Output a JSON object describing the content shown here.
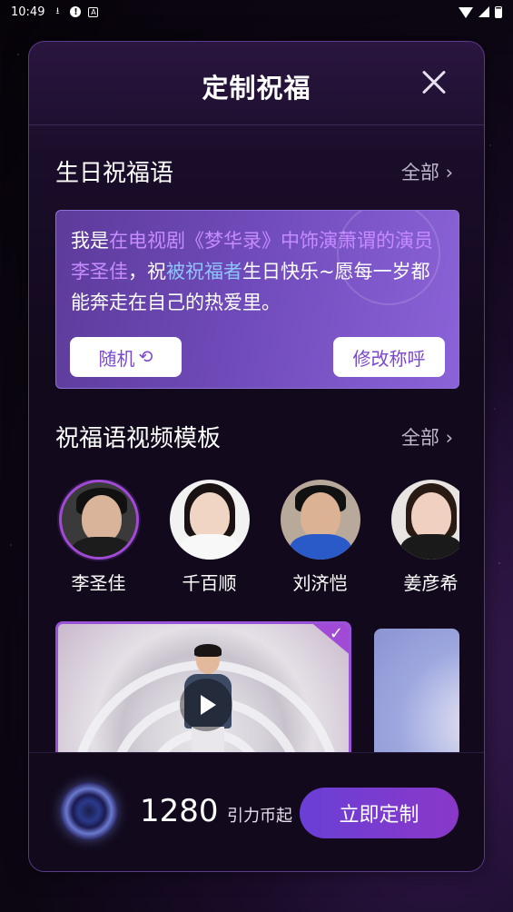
{
  "status_bar": {
    "time": "10:49",
    "icons_left": [
      "download-icon",
      "alert-icon",
      "app-a-icon"
    ],
    "icons_right": [
      "wifi-icon",
      "signal-icon",
      "battery-icon"
    ]
  },
  "dialog": {
    "title": "定制祝福",
    "close_icon": "close-icon"
  },
  "greeting_section": {
    "title": "生日祝福语",
    "more_label": "全部",
    "more_icon": "chevron-right-icon",
    "text_prefix": "我是",
    "text_identity": "在电视剧《梦华录》中饰演萧谓的演员李圣佳",
    "text_comma": "，祝",
    "text_recipient": "被祝福者",
    "text_suffix": "生日快乐~愿每一岁都能奔走在自己的热爱里。",
    "random_button": "随机",
    "random_icon": "refresh-icon",
    "modify_button": "修改称呼"
  },
  "template_section": {
    "title": "祝福语视频模板",
    "more_label": "全部",
    "celebrities": [
      {
        "name": "李圣佳",
        "selected": true
      },
      {
        "name": "千百顺",
        "selected": false
      },
      {
        "name": "刘济恺",
        "selected": false
      },
      {
        "name": "姜彦希",
        "selected": false
      }
    ]
  },
  "videos": {
    "play_icon": "play-icon",
    "check_icon": "check-icon"
  },
  "footer": {
    "coin_icon": "coin-icon",
    "price": "1280",
    "unit": "引力币起",
    "order_button": "立即定制"
  },
  "colors": {
    "accent": "#8a38c8",
    "highlight_pink": "#c68cff",
    "highlight_blue": "#8ec5ff",
    "card_purple": "#6f4ab9"
  }
}
